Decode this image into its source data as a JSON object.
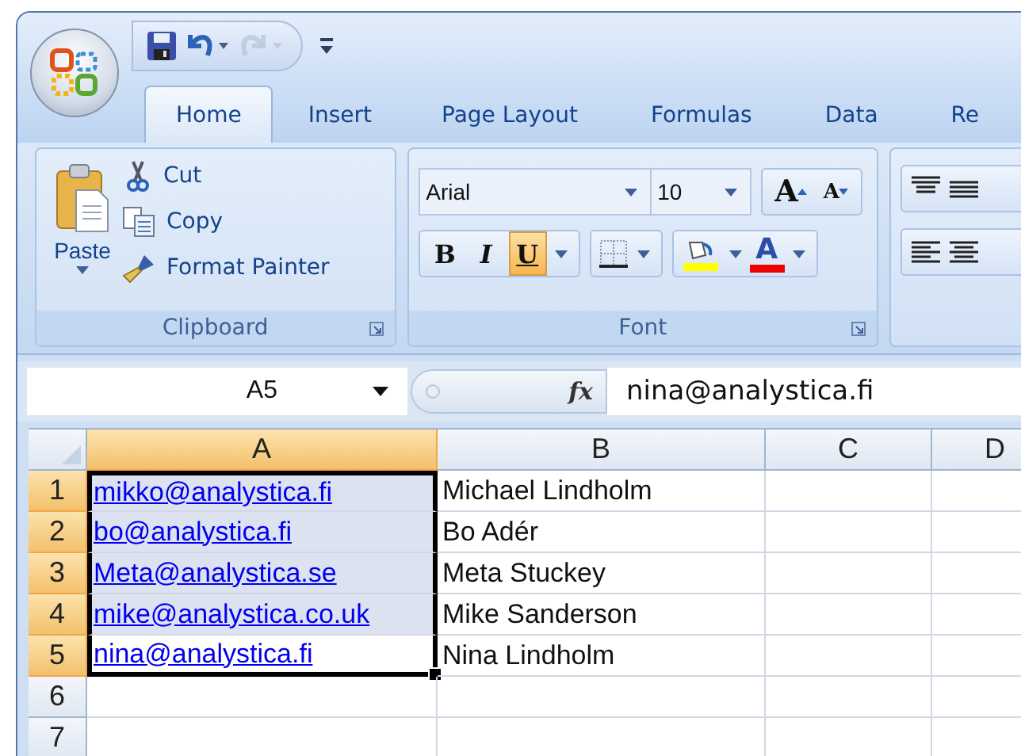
{
  "quick_access": [
    {
      "kind": "save",
      "disabled": false
    },
    {
      "kind": "undo",
      "disabled": false
    },
    {
      "kind": "redo",
      "disabled": true
    }
  ],
  "tabs": [
    {
      "label": "Home",
      "selected": true
    },
    {
      "label": "Insert",
      "selected": false
    },
    {
      "label": "Page Layout",
      "selected": false
    },
    {
      "label": "Formulas",
      "selected": false
    },
    {
      "label": "Data",
      "selected": false
    },
    {
      "label": "Re",
      "selected": false
    }
  ],
  "clipboard": {
    "title": "Clipboard",
    "paste": "Paste",
    "commands": [
      {
        "kind": "cut",
        "label": "Cut"
      },
      {
        "kind": "copy",
        "label": "Copy"
      },
      {
        "kind": "painter",
        "label": "Format Painter"
      }
    ]
  },
  "font": {
    "title": "Font",
    "family": "Arial",
    "size": "10",
    "grow": "A",
    "shrink": "A",
    "styles": [
      {
        "kind": "bold",
        "label": "B",
        "on": false
      },
      {
        "kind": "italic",
        "label": "I",
        "on": false
      },
      {
        "kind": "underline",
        "label": "U",
        "on": true
      }
    ],
    "font_color": "A"
  },
  "formula_bar": {
    "name_box": "A5",
    "fx": "fx",
    "value": "nina@analystica.fi"
  },
  "sheet": {
    "columns": [
      {
        "label": "A",
        "selected": true
      },
      {
        "label": "B",
        "selected": false
      },
      {
        "label": "C",
        "selected": false
      },
      {
        "label": "D",
        "selected": false
      }
    ],
    "rows": [
      {
        "header": "1",
        "selected": true,
        "active": false,
        "cells": [
          {
            "kind": "link",
            "text": "mikko@analystica.fi"
          },
          {
            "kind": "text",
            "text": "Michael Lindholm"
          }
        ]
      },
      {
        "header": "2",
        "selected": true,
        "active": false,
        "cells": [
          {
            "kind": "link",
            "text": "bo@analystica.fi"
          },
          {
            "kind": "text",
            "text": "Bo Adér"
          }
        ]
      },
      {
        "header": "3",
        "selected": true,
        "active": false,
        "cells": [
          {
            "kind": "link",
            "text": "Meta@analystica.se"
          },
          {
            "kind": "text",
            "text": "Meta Stuckey"
          }
        ]
      },
      {
        "header": "4",
        "selected": true,
        "active": false,
        "cells": [
          {
            "kind": "link",
            "text": "mike@analystica.co.uk"
          },
          {
            "kind": "text",
            "text": "Mike Sanderson"
          }
        ]
      },
      {
        "header": "5",
        "selected": true,
        "active": true,
        "cells": [
          {
            "kind": "link",
            "text": "nina@analystica.fi"
          },
          {
            "kind": "text",
            "text": "Nina Lindholm"
          }
        ]
      },
      {
        "header": "6",
        "selected": false,
        "active": false,
        "cells": []
      },
      {
        "header": "7",
        "selected": false,
        "active": false,
        "cells": []
      }
    ]
  }
}
